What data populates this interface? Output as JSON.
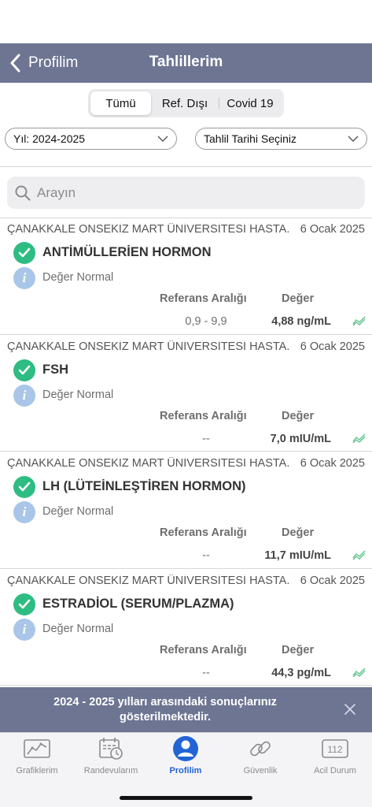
{
  "nav": {
    "back_label": "Profilim",
    "title": "Tahlillerim"
  },
  "segments": [
    {
      "label": "Tümü",
      "active": true
    },
    {
      "label": "Ref. Dışı",
      "active": false
    },
    {
      "label": "Covid 19",
      "active": false
    }
  ],
  "filters": {
    "year": "Yıl: 2024-2025",
    "date": "Tahlil Tarihi Seçiniz"
  },
  "search": {
    "placeholder": "Arayın"
  },
  "results": [
    {
      "hospital": "ÇANAKKALE ONSEKİZ MART ÜNİVERSİTESİ HASTA...",
      "date": "6 Ocak 2025",
      "name": "ANTİMÜLLERİEN HORMON",
      "status": "Değer Normal",
      "ref_header": "Referans Aralığı",
      "val_header": "Değer",
      "ref": "0,9 - 9,9",
      "value": "4,88 ng/mL"
    },
    {
      "hospital": "ÇANAKKALE ONSEKİZ MART ÜNİVERSİTESİ HASTA...",
      "date": "6 Ocak 2025",
      "name": "FSH",
      "status": "Değer Normal",
      "ref_header": "Referans Aralığı",
      "val_header": "Değer",
      "ref": "--",
      "value": "7,0 mIU/mL"
    },
    {
      "hospital": "ÇANAKKALE ONSEKİZ MART ÜNİVERSİTESİ HASTA...",
      "date": "6 Ocak 2025",
      "name": "LH (LÜTEİNLEŞTİREN HORMON)",
      "status": "Değer Normal",
      "ref_header": "Referans Aralığı",
      "val_header": "Değer",
      "ref": "--",
      "value": "11,7 mIU/mL"
    },
    {
      "hospital": "ÇANAKKALE ONSEKİZ MART ÜNİVERSİTESİ HASTA...",
      "date": "6 Ocak 2025",
      "name": "ESTRADİOL (SERUM/PLAZMA)",
      "status": "Değer Normal",
      "ref_header": "Referans Aralığı",
      "val_header": "Değer",
      "ref": "--",
      "value": "44,3 pg/mL"
    }
  ],
  "banner": {
    "text": "2024 - 2025 yılları arasındaki sonuçlarınız gösterilmektedir."
  },
  "tabs": [
    {
      "label": "Grafiklerim",
      "icon": "chart-icon",
      "active": false
    },
    {
      "label": "Randevularım",
      "icon": "calendar-clock-icon",
      "active": false
    },
    {
      "label": "Profilim",
      "icon": "person-icon",
      "active": true
    },
    {
      "label": "Güvenlik",
      "icon": "link-icon",
      "active": false
    },
    {
      "label": "Acil Durum",
      "icon": "emergency-112-icon",
      "active": false,
      "badge": "112"
    }
  ],
  "colors": {
    "navbar": "#6d7592",
    "check_green": "#2ebc82",
    "info_blue": "#a9c6e8",
    "tab_active": "#2264d6"
  }
}
